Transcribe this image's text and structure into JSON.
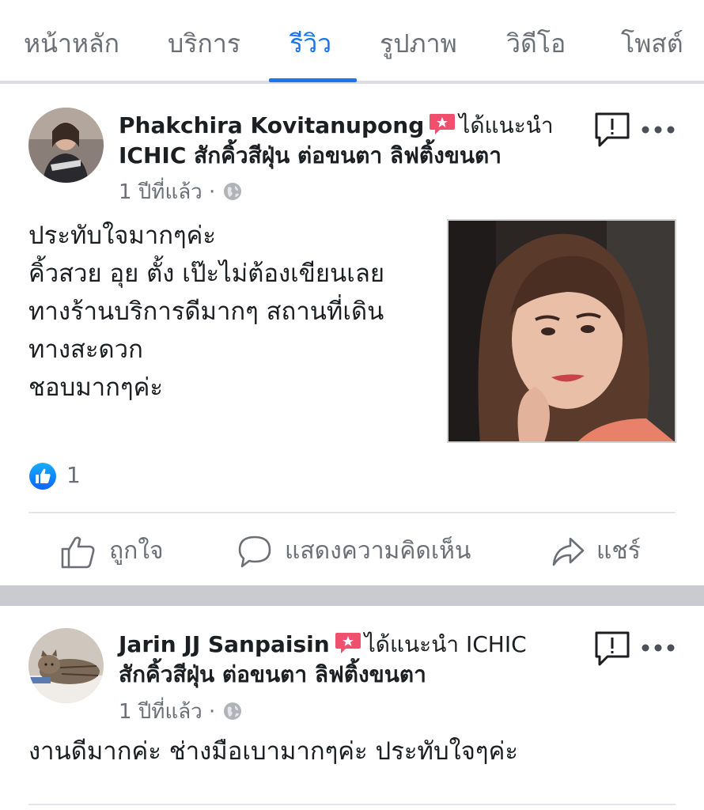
{
  "tabs": [
    {
      "label": "หน้าหลัก"
    },
    {
      "label": "บริการ"
    },
    {
      "label": "รีวิว"
    },
    {
      "label": "รูปภาพ"
    },
    {
      "label": "วิดีโอ"
    },
    {
      "label": "โพสต์"
    }
  ],
  "active_tab": "รีวิว",
  "accent_color": "#1a75e8",
  "recommend_icon_color": "#f0506e",
  "posts": [
    {
      "author": "Phakchira Kovitanupong",
      "recommend_text": "ได้แนะนำ",
      "page_name": "ICHIC สักคิ้วสีฝุ่น ต่อขนตา ลิฟติ้งขนตา",
      "time": "1 ปีที่แล้ว",
      "separator": "·",
      "body_lines": [
        "ประทับใจมากๆค่ะ",
        "คิ้วสวย อุย ตั้ง เป๊ะไม่ต้องเขียนเลย",
        "ทางร้านบริการดีมากๆ สถานที่เดิน",
        "ทางสะดวก",
        "ชอบมากๆค่ะ"
      ],
      "like_count": "1",
      "actions": {
        "like": "ถูกใจ",
        "comment": "แสดงความคิดเห็น",
        "share": "แชร์"
      }
    },
    {
      "author": "Jarin JJ Sanpaisin",
      "recommend_text": "ได้แนะนำ ICHIC",
      "page_name": "สักคิ้วสีฝุ่น ต่อขนตา ลิฟติ้งขนตา",
      "time": "1 ปีที่แล้ว",
      "separator": "·",
      "body_lines": [
        "งานดีมากค่ะ ช่างมือเบามากๆค่ะ ประทับใจๆค่ะ"
      ]
    }
  ]
}
